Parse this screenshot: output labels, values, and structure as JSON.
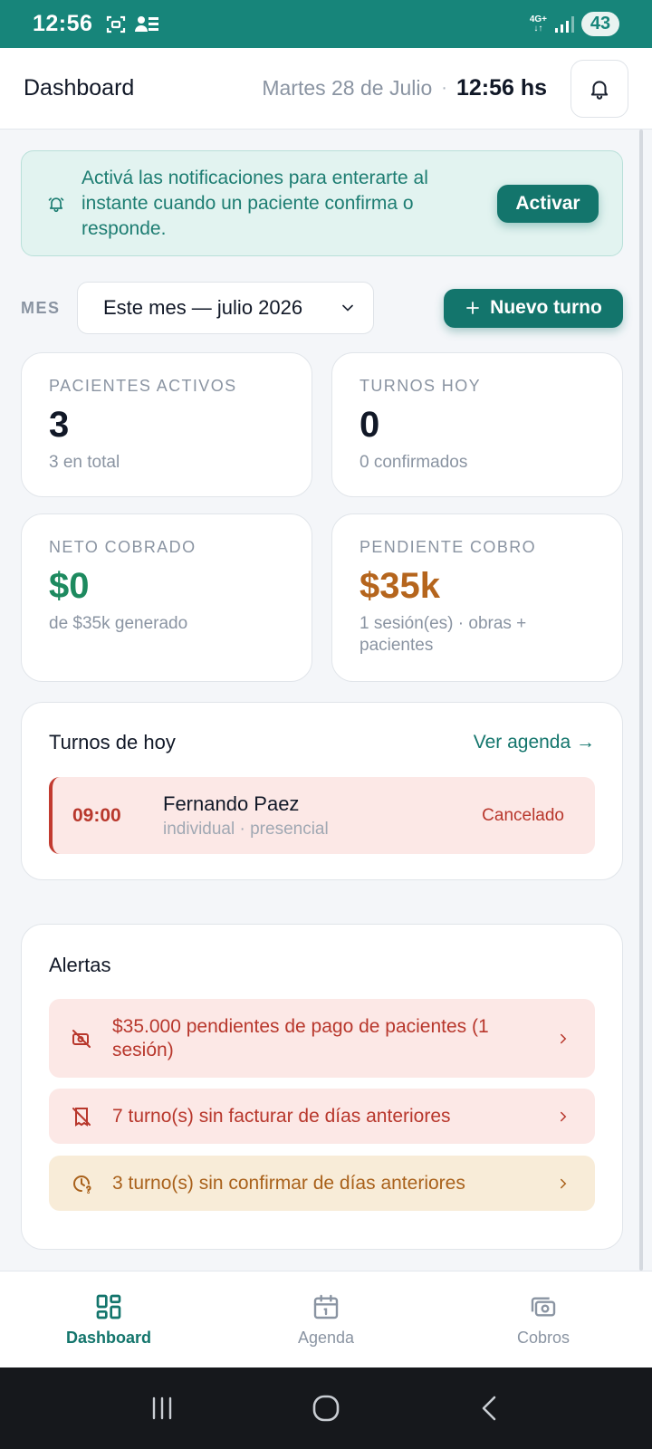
{
  "status_bar": {
    "time": "12:56",
    "network": "4G+",
    "battery": "43"
  },
  "header": {
    "title": "Dashboard",
    "date": "Martes 28 de Julio",
    "separator": "·",
    "time": "12:56 hs"
  },
  "banner": {
    "text": "Activá las notificaciones para enterarte al instante cuando un paciente confirma o responde.",
    "button": "Activar"
  },
  "filters": {
    "month_label": "MES",
    "month_value": "Este mes — julio 2026",
    "new_turn_button": "Nuevo turno"
  },
  "stats": [
    {
      "label": "PACIENTES ACTIVOS",
      "value": "3",
      "sub": "3 en total",
      "color": "#111827"
    },
    {
      "label": "TURNOS HOY",
      "value": "0",
      "sub": "0 confirmados",
      "color": "#111827"
    },
    {
      "label": "NETO COBRADO",
      "value": "$0",
      "sub": "de $35k generado",
      "color": "#1d8a5f"
    },
    {
      "label": "PENDIENTE COBRO",
      "value": "$35k",
      "sub": "1 sesión(es) · obras + pacientes",
      "color": "#b5651d"
    }
  ],
  "today": {
    "title": "Turnos de hoy",
    "link": "Ver agenda →",
    "appointments": [
      {
        "time": "09:00",
        "name": "Fernando Paez",
        "meta": "individual · presencial",
        "status": "Cancelado"
      }
    ]
  },
  "alerts": {
    "title": "Alertas",
    "items": [
      {
        "text": "$35.000 pendientes de pago de pacientes (1 sesión)",
        "tone": "red",
        "icon": "money-off-icon"
      },
      {
        "text": "7 turno(s) sin facturar de días anteriores",
        "tone": "red",
        "icon": "receipt-off-icon"
      },
      {
        "text": "3 turno(s) sin confirmar de días anteriores",
        "tone": "amber",
        "icon": "clock-question-icon"
      }
    ]
  },
  "bottom_nav": [
    {
      "label": "Dashboard",
      "icon": "grid-icon",
      "active": true
    },
    {
      "label": "Agenda",
      "icon": "calendar-icon",
      "active": false
    },
    {
      "label": "Cobros",
      "icon": "cash-icon",
      "active": false
    }
  ],
  "colors": {
    "brand": "#13756c",
    "status_bar": "#17857a",
    "danger": "#b8372c",
    "warning": "#a9611b",
    "success": "#1d8a5f"
  }
}
